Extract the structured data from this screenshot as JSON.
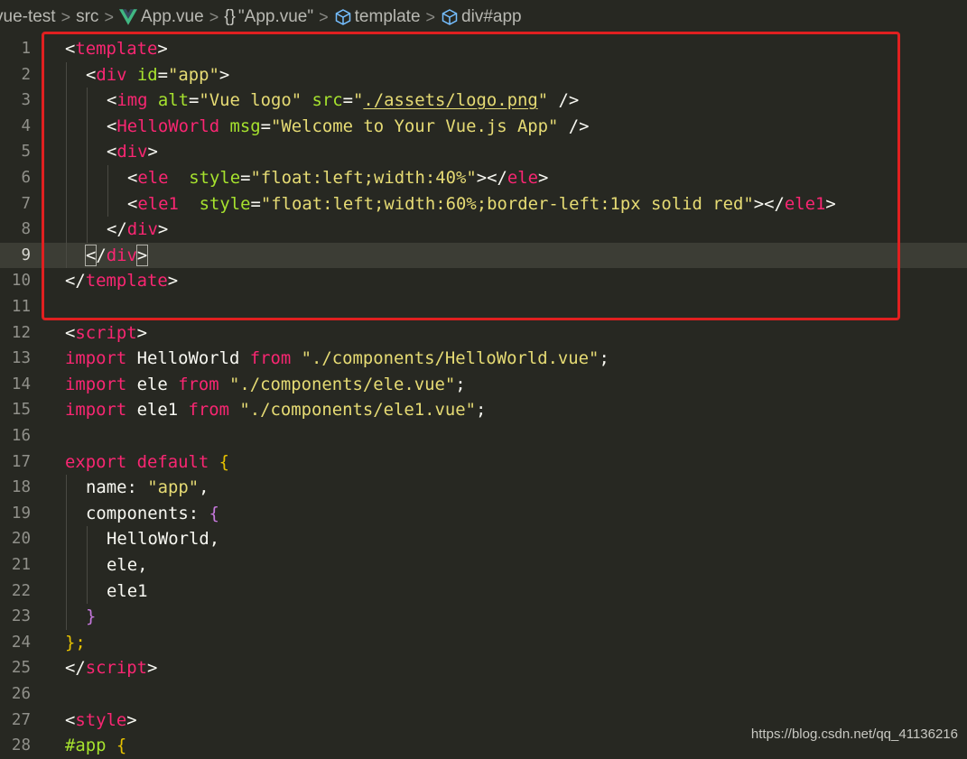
{
  "breadcrumb": {
    "items": [
      {
        "label": "vue-test"
      },
      {
        "label": "src"
      },
      {
        "label": "App.vue",
        "icon": "vue-icon"
      },
      {
        "label": "\"App.vue\"",
        "icon": "braces-icon"
      },
      {
        "label": "template",
        "icon": "cube-icon"
      },
      {
        "label": "div#app",
        "icon": "cube-icon"
      }
    ],
    "braces_glyph": "{}"
  },
  "editor": {
    "active_line": 9,
    "lines": [
      {
        "n": "1"
      },
      {
        "n": "2"
      },
      {
        "n": "3"
      },
      {
        "n": "4"
      },
      {
        "n": "5"
      },
      {
        "n": "6"
      },
      {
        "n": "7"
      },
      {
        "n": "8"
      },
      {
        "n": "9"
      },
      {
        "n": "10"
      },
      {
        "n": "11"
      },
      {
        "n": "12"
      },
      {
        "n": "13"
      },
      {
        "n": "14"
      },
      {
        "n": "15"
      },
      {
        "n": "16"
      },
      {
        "n": "17"
      },
      {
        "n": "18"
      },
      {
        "n": "19"
      },
      {
        "n": "20"
      },
      {
        "n": "21"
      },
      {
        "n": "22"
      },
      {
        "n": "23"
      },
      {
        "n": "24"
      },
      {
        "n": "25"
      },
      {
        "n": "26"
      },
      {
        "n": "27"
      },
      {
        "n": "28"
      }
    ],
    "tokens": {
      "l1": [
        "<",
        "template",
        ">"
      ],
      "l2": [
        "<",
        "div",
        " ",
        "id",
        "=",
        "\"app\"",
        ">"
      ],
      "l3": [
        "<",
        "img",
        " ",
        "alt",
        "=",
        "\"Vue logo\"",
        " ",
        "src",
        "=",
        "\"",
        "./assets/logo.png",
        "\"",
        " />"
      ],
      "l4": [
        "<",
        "HelloWorld",
        " ",
        "msg",
        "=",
        "\"Welcome to Your Vue.js App\"",
        " />"
      ],
      "l5": [
        "<",
        "div",
        ">"
      ],
      "l6": [
        "<",
        "ele",
        "  ",
        "style",
        "=",
        "\"float:left;width:40%\"",
        "></",
        "ele",
        ">"
      ],
      "l7": [
        "<",
        "ele1",
        "  ",
        "style",
        "=",
        "\"float:left;width:60%;border-left:1px solid red\"",
        "></",
        "ele1",
        ">"
      ],
      "l8": [
        "</",
        "div",
        ">"
      ],
      "l9": [
        "<",
        "/",
        "div",
        ">"
      ],
      "l10": [
        "</",
        "template",
        ">"
      ],
      "l12": [
        "<",
        "script",
        ">"
      ],
      "l13": [
        "import",
        " HelloWorld ",
        "from",
        " ",
        "\"./components/HelloWorld.vue\"",
        ";"
      ],
      "l14": [
        "import",
        " ele ",
        "from",
        " ",
        "\"./components/ele.vue\"",
        ";"
      ],
      "l15": [
        "import",
        " ele1 ",
        "from",
        " ",
        "\"./components/ele1.vue\"",
        ";"
      ],
      "l17": [
        "export",
        " ",
        "default",
        " ",
        "{"
      ],
      "l18": [
        "name: ",
        "\"app\"",
        ","
      ],
      "l19": [
        "components: ",
        "{"
      ],
      "l20": [
        "HelloWorld,"
      ],
      "l21": [
        "ele,"
      ],
      "l22": [
        "ele1"
      ],
      "l23": [
        "}"
      ],
      "l24": [
        "};"
      ],
      "l25": [
        "</",
        "script",
        ">"
      ],
      "l27": [
        "<",
        "style",
        ">"
      ],
      "l28": [
        "#app",
        " ",
        "{"
      ]
    }
  },
  "colors": {
    "background": "#272822",
    "tag": "#f92672",
    "attribute": "#a6e22e",
    "string": "#e6db74",
    "highlight_box": "#e02020"
  },
  "watermark": "https://blog.csdn.net/qq_41136216"
}
